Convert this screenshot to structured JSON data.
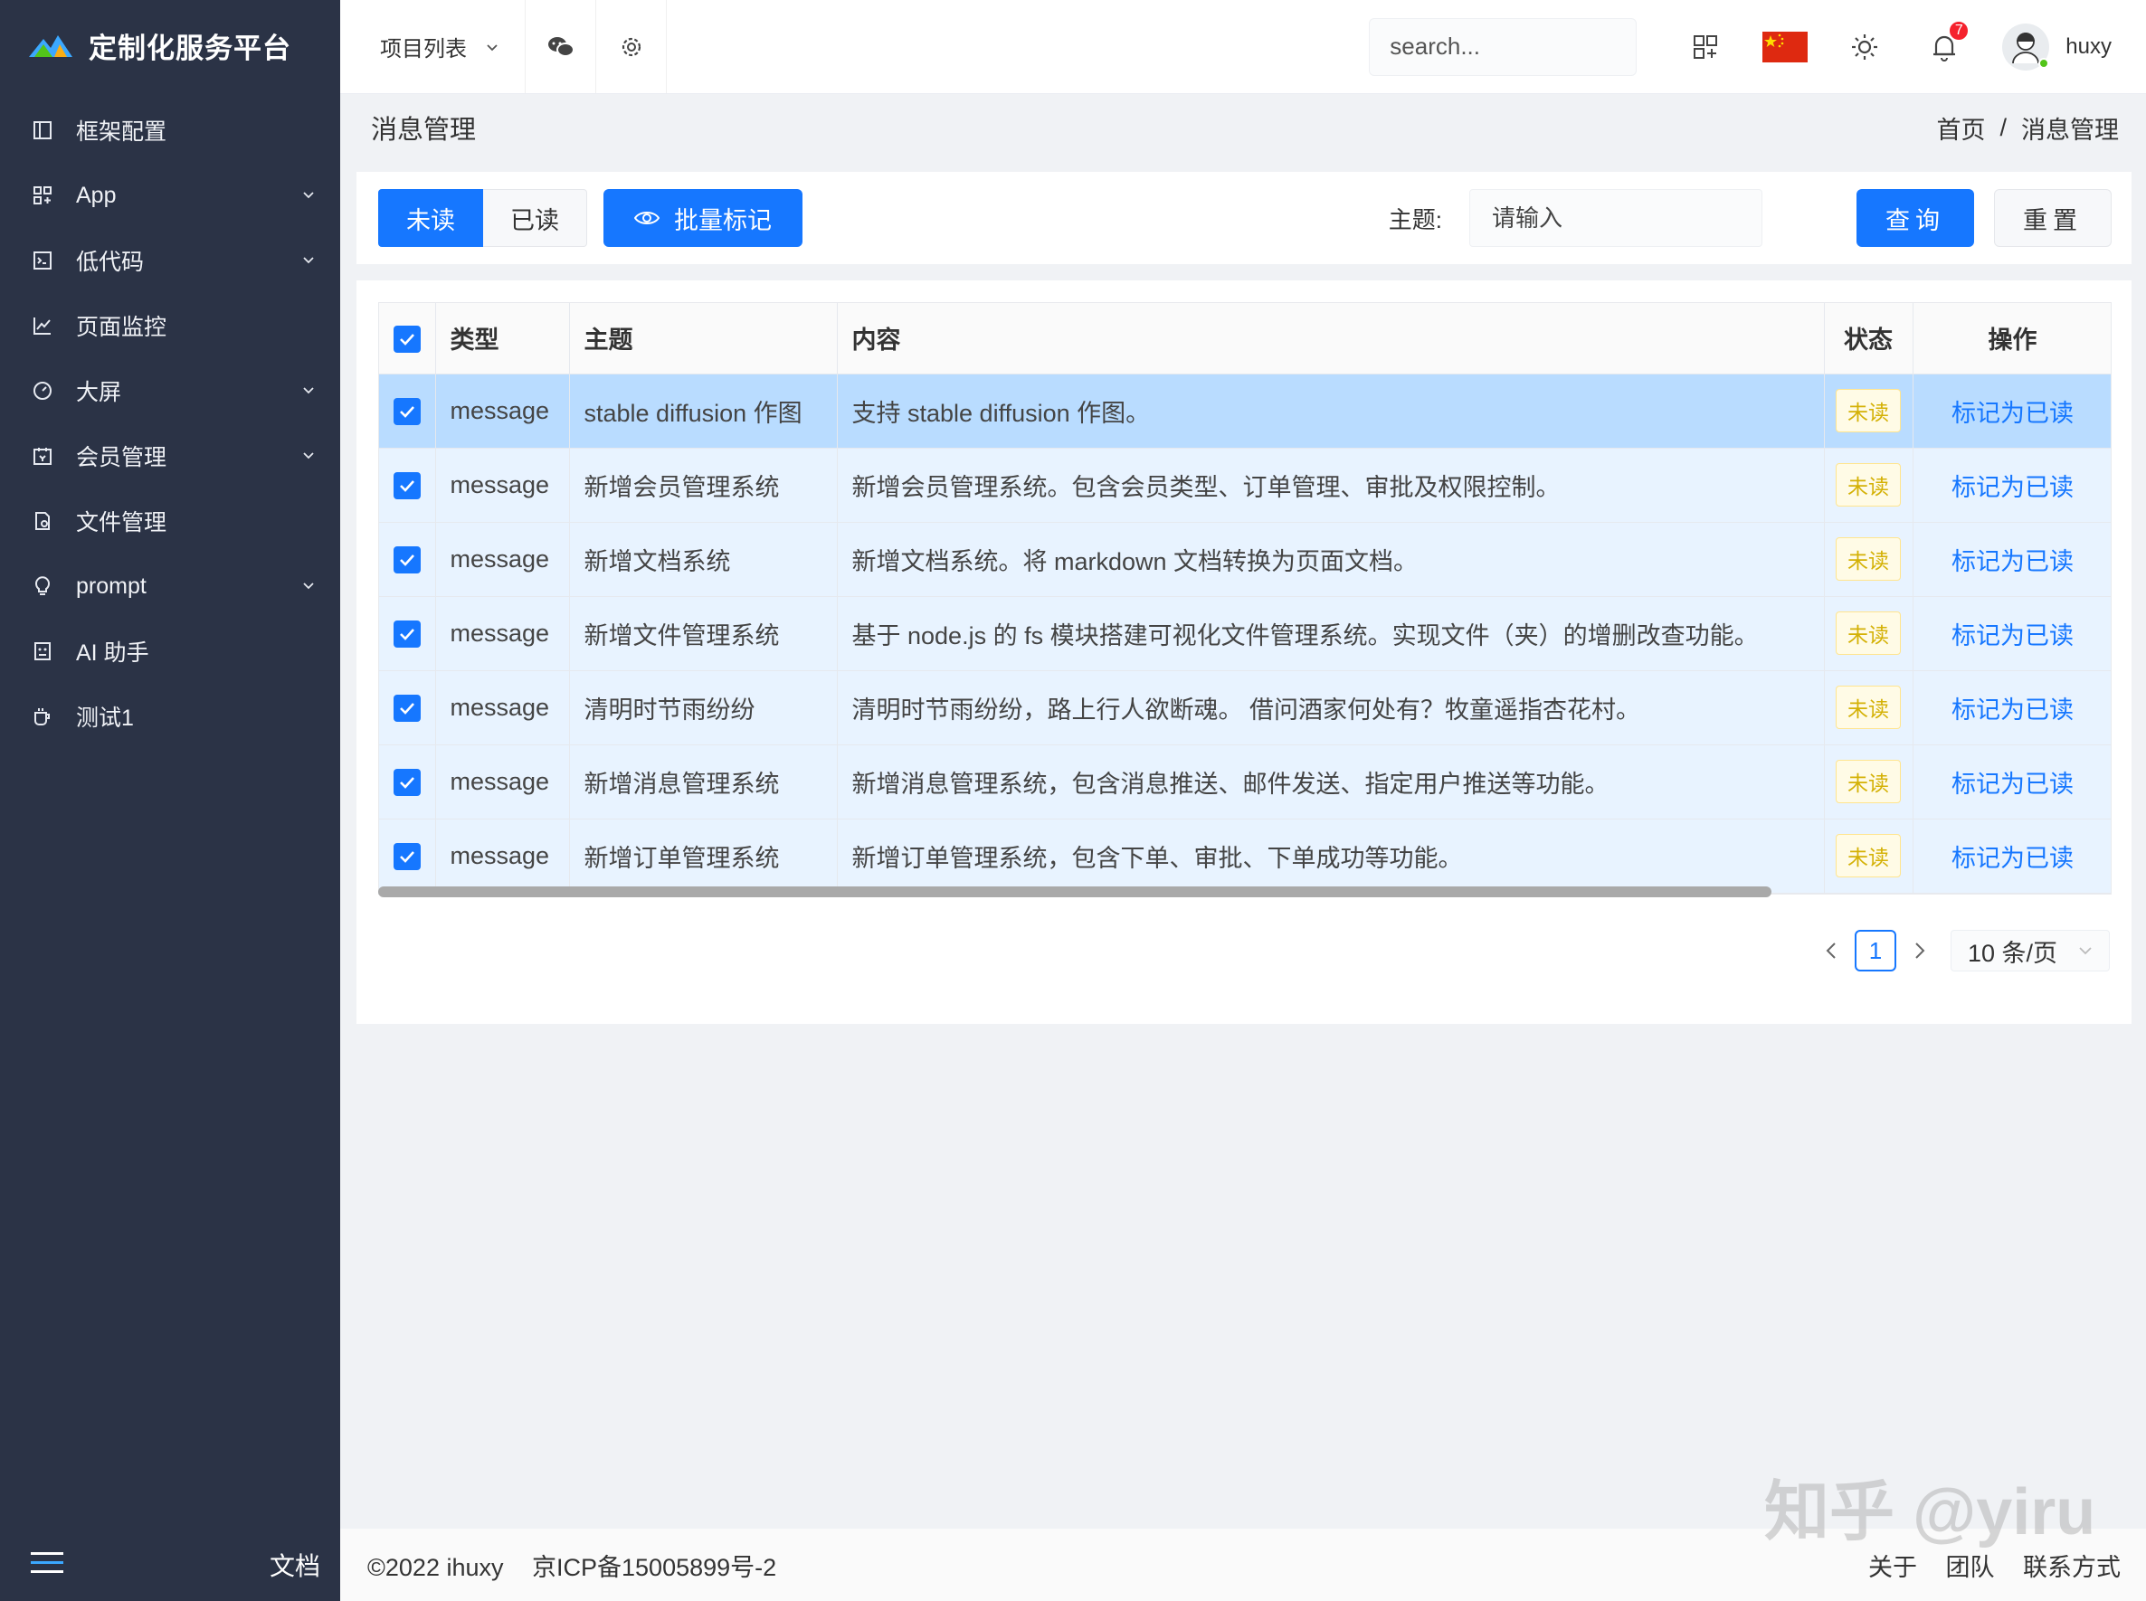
{
  "app": {
    "title": "定制化服务平台"
  },
  "sidebar": {
    "items": [
      {
        "label": "框架配置",
        "icon": "layout-icon",
        "expandable": false
      },
      {
        "label": "App",
        "icon": "app-grid-icon",
        "expandable": true
      },
      {
        "label": "低代码",
        "icon": "code-icon",
        "expandable": true
      },
      {
        "label": "页面监控",
        "icon": "line-chart-icon",
        "expandable": false
      },
      {
        "label": "大屏",
        "icon": "dashboard-icon",
        "expandable": true
      },
      {
        "label": "会员管理",
        "icon": "member-icon",
        "expandable": true
      },
      {
        "label": "文件管理",
        "icon": "file-icon",
        "expandable": false
      },
      {
        "label": "prompt",
        "icon": "bulb-icon",
        "expandable": true
      },
      {
        "label": "AI 助手",
        "icon": "robot-icon",
        "expandable": false
      },
      {
        "label": "测试1",
        "icon": "cup-icon",
        "expandable": false
      }
    ],
    "bottom": {
      "docs_label": "文档"
    }
  },
  "header": {
    "project_dropdown": "项目列表",
    "search_placeholder": "search...",
    "notification_count": "7",
    "username": "huxy"
  },
  "page": {
    "title": "消息管理",
    "breadcrumb": {
      "home": "首页",
      "separator": "/",
      "current": "消息管理"
    }
  },
  "filter": {
    "tab_unread": "未读",
    "tab_read": "已读",
    "batch_mark": "批量标记",
    "subject_label": "主题:",
    "subject_placeholder": "请输入",
    "query_button": "查询",
    "reset_button": "重置"
  },
  "table": {
    "columns": [
      "类型",
      "主题",
      "内容",
      "状态",
      "操作"
    ],
    "rows": [
      {
        "type": "message",
        "subject": "stable diffusion 作图",
        "content": "支持 stable diffusion 作图。",
        "status": "未读",
        "action": "标记为已读"
      },
      {
        "type": "message",
        "subject": "新增会员管理系统",
        "content": "新增会员管理系统。包含会员类型、订单管理、审批及权限控制。",
        "status": "未读",
        "action": "标记为已读"
      },
      {
        "type": "message",
        "subject": "新增文档系统",
        "content": "新增文档系统。将 markdown 文档转换为页面文档。",
        "status": "未读",
        "action": "标记为已读"
      },
      {
        "type": "message",
        "subject": "新增文件管理系统",
        "content": "基于 node.js 的 fs 模块搭建可视化文件管理系统。实现文件（夹）的增删改查功能。",
        "status": "未读",
        "action": "标记为已读"
      },
      {
        "type": "message",
        "subject": "清明时节雨纷纷",
        "content": "清明时节雨纷纷，路上行人欲断魂。 借问酒家何处有？牧童遥指杏花村。",
        "status": "未读",
        "action": "标记为已读"
      },
      {
        "type": "message",
        "subject": "新增消息管理系统",
        "content": "新增消息管理系统，包含消息推送、邮件发送、指定用户推送等功能。",
        "status": "未读",
        "action": "标记为已读"
      },
      {
        "type": "message",
        "subject": "新增订单管理系统",
        "content": "新增订单管理系统，包含下单、审批、下单成功等功能。",
        "status": "未读",
        "action": "标记为已读"
      }
    ]
  },
  "pagination": {
    "current_page": "1",
    "page_size": "10 条/页"
  },
  "footer": {
    "copyright": "©2022 ihuxy",
    "icp": "京ICP备15005899号-2",
    "links": [
      "关于",
      "团队",
      "联系方式"
    ]
  },
  "watermark": "知乎 @yiru",
  "colors": {
    "primary": "#1677ff",
    "sidebar_bg": "#2b3346",
    "row_selected": "#e8f3ff",
    "row_highlight": "#b9dcff"
  }
}
